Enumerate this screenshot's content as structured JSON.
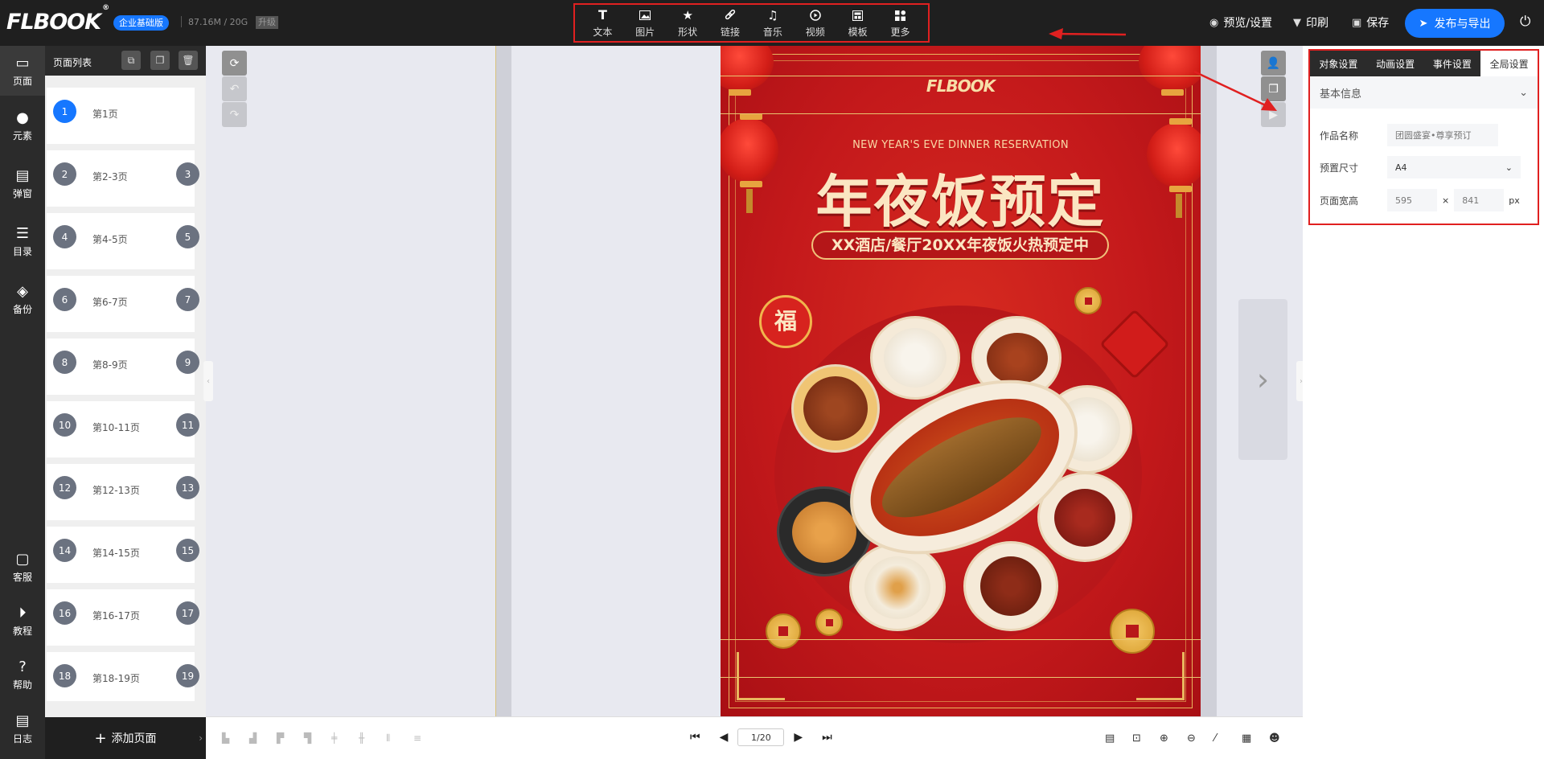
{
  "header": {
    "logo": "FLBOOK",
    "logo_mark": "®",
    "plan_badge": "企业基础版",
    "storage": "87.16M / 20G",
    "upgrade": "升级",
    "tools": [
      {
        "label": "文本",
        "icon": "text-icon"
      },
      {
        "label": "图片",
        "icon": "image-icon"
      },
      {
        "label": "形状",
        "icon": "star-icon"
      },
      {
        "label": "链接",
        "icon": "link-icon"
      },
      {
        "label": "音乐",
        "icon": "music-icon"
      },
      {
        "label": "视频",
        "icon": "video-icon"
      },
      {
        "label": "模板",
        "icon": "template-icon"
      },
      {
        "label": "更多",
        "icon": "more-icon"
      }
    ],
    "preview_label": "预览/设置",
    "print_label": "印刷",
    "save_label": "保存",
    "publish_label": "发布与导出"
  },
  "leftnav": {
    "items": [
      {
        "label": "页面",
        "icon": "page-icon",
        "active": true
      },
      {
        "label": "元素",
        "icon": "elements-icon"
      },
      {
        "label": "弹窗",
        "icon": "popup-icon"
      },
      {
        "label": "目录",
        "icon": "toc-icon"
      },
      {
        "label": "备份",
        "icon": "backup-icon"
      },
      {
        "label": "客服",
        "icon": "support-icon"
      },
      {
        "label": "教程",
        "icon": "tutorial-icon"
      },
      {
        "label": "帮助",
        "icon": "help-icon"
      },
      {
        "label": "日志",
        "icon": "log-icon"
      }
    ]
  },
  "pagelist": {
    "title": "页面列表",
    "add_label": "添加页面",
    "rows": [
      {
        "num": "1",
        "label": "第1页"
      },
      {
        "num": "2",
        "num2": "3",
        "label": "第2-3页"
      },
      {
        "num": "4",
        "num2": "5",
        "label": "第4-5页"
      },
      {
        "num": "6",
        "num2": "7",
        "label": "第6-7页"
      },
      {
        "num": "8",
        "num2": "9",
        "label": "第8-9页"
      },
      {
        "num": "10",
        "num2": "11",
        "label": "第10-11页"
      },
      {
        "num": "12",
        "num2": "13",
        "label": "第12-13页"
      },
      {
        "num": "14",
        "num2": "15",
        "label": "第14-15页"
      },
      {
        "num": "16",
        "num2": "17",
        "label": "第16-17页"
      },
      {
        "num": "18",
        "num2": "19",
        "label": "第18-19页"
      }
    ]
  },
  "poster": {
    "logo": "FLBOOK",
    "subtitle": "NEW YEAR'S EVE DINNER RESERVATION",
    "title": "年夜饭预定",
    "banner": "XX酒店/餐厅20XX年夜饭火热预定中",
    "fu": "福"
  },
  "pager": {
    "value": "1/20"
  },
  "rightpanel": {
    "tabs": [
      "对象设置",
      "动画设置",
      "事件设置",
      "全局设置"
    ],
    "active_tab": 3,
    "section": "基本信息",
    "fields": {
      "name_label": "作品名称",
      "name_value": "团圆盛宴•尊享预订",
      "size_label": "预置尺寸",
      "size_value": "A4",
      "wh_label": "页面宽高",
      "width": "595",
      "height": "841",
      "times": "×",
      "unit": "px"
    }
  },
  "colors": {
    "accent": "#1677ff",
    "highlight": "#e02020",
    "poster_red": "#c4191b",
    "gold": "#e9b75e"
  }
}
